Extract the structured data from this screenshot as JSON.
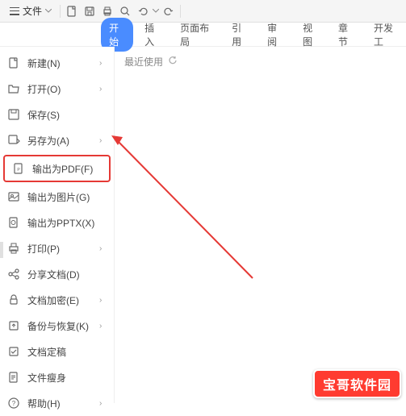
{
  "titlebar": {
    "file_label": "文件"
  },
  "tabs": {
    "start": "开始",
    "insert": "插入",
    "page_layout": "页面布局",
    "reference": "引用",
    "review": "审阅",
    "view": "视图",
    "chapter": "章节",
    "devtools": "开发工"
  },
  "menu": {
    "new": "新建(N)",
    "open": "打开(O)",
    "save": "保存(S)",
    "save_as": "另存为(A)",
    "export_pdf": "输出为PDF(F)",
    "export_image": "输出为图片(G)",
    "export_pptx": "输出为PPTX(X)",
    "print": "打印(P)",
    "share": "分享文档(D)",
    "encrypt": "文档加密(E)",
    "backup": "备份与恢复(K)",
    "finalize": "文档定稿",
    "slim": "文件瘦身",
    "help": "帮助(H)"
  },
  "content": {
    "recent": "最近使用"
  },
  "watermark": "宝哥软件园"
}
